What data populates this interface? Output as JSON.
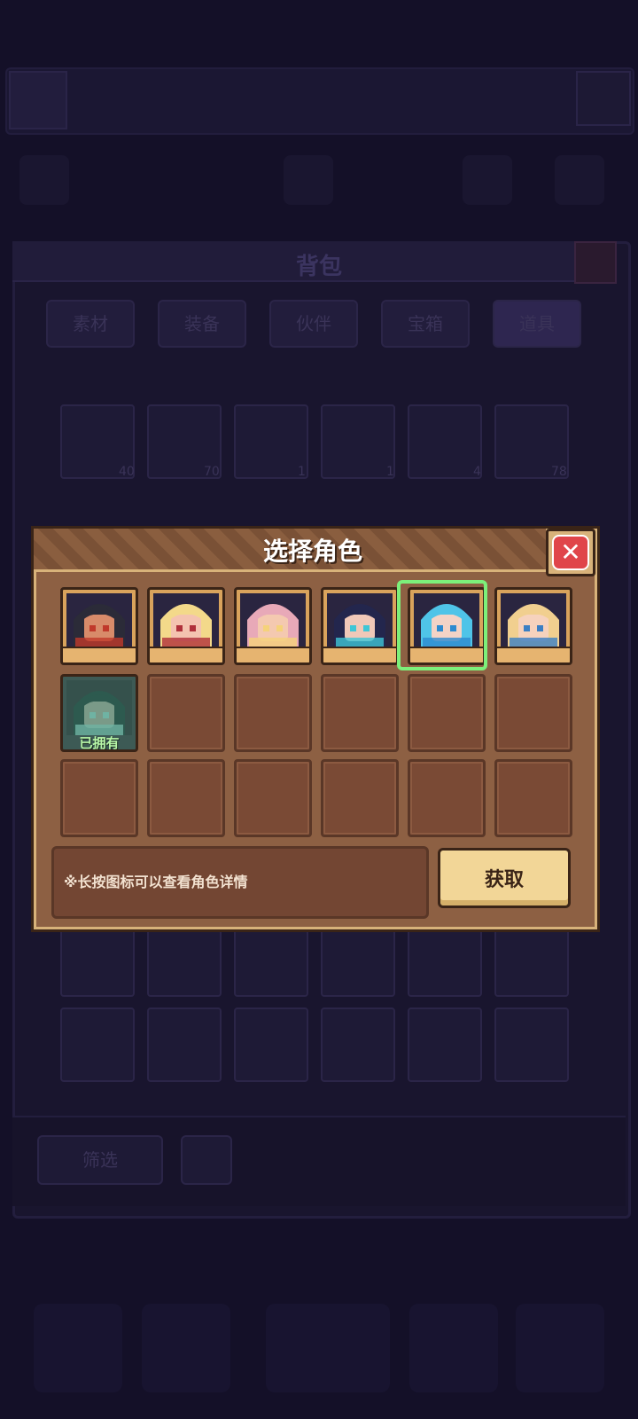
{
  "background": {
    "top_stats": [
      "",
      "",
      "",
      "",
      ""
    ],
    "panel_title": "背包",
    "tabs": [
      "素材",
      "装备",
      "伙伴",
      "宝箱",
      "道具"
    ],
    "item_counts": [
      "40",
      "70",
      "1",
      "1",
      "4",
      "78"
    ],
    "filter_label": "筛选"
  },
  "dialog": {
    "title": "选择角色",
    "owned_label": "已拥有",
    "hint": "※长按图标可以查看角色详情",
    "get_button": "获取"
  },
  "characters": [
    {
      "id": "char-1",
      "hair": "#2b2b38",
      "skin": "#d88b6a",
      "accent": "#c0392b"
    },
    {
      "id": "char-2",
      "hair": "#f3d98a",
      "skin": "#f4c3b0",
      "accent": "#b0303a"
    },
    {
      "id": "char-3",
      "hair": "#e8a9b8",
      "skin": "#f4c9b0",
      "accent": "#f5d27a"
    },
    {
      "id": "char-4",
      "hair": "#23264d",
      "skin": "#f0c8b8",
      "accent": "#3fc6d6"
    },
    {
      "id": "char-5",
      "hair": "#4fc4e8",
      "skin": "#f3d3c6",
      "accent": "#2d8bd0"
    },
    {
      "id": "char-6",
      "hair": "#f1cf8f",
      "skin": "#f6d2bd",
      "accent": "#3b7fc4"
    },
    {
      "id": "char-7",
      "hair": "#2d5a4f",
      "skin": "#7a9a88",
      "accent": "#6fb3a3",
      "owned": true
    }
  ],
  "selected_index": 4
}
